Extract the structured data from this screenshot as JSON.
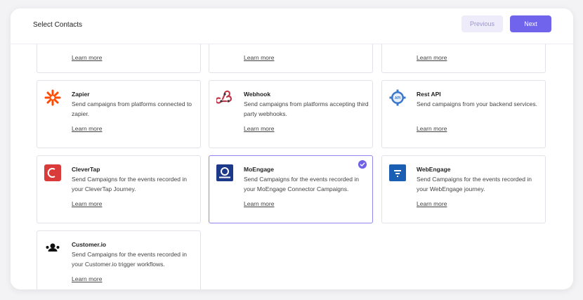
{
  "header": {
    "title": "Select Contacts",
    "previous_label": "Previous",
    "next_label": "Next"
  },
  "top_row": {
    "learn_more": "Learn more"
  },
  "cards": [
    {
      "title": "Zapier",
      "description": "Send campaigns from platforms connected to zapier.",
      "learn_more": "Learn more",
      "icon": "zapier-icon"
    },
    {
      "title": "Webhook",
      "description": "Send campaigns from platforms accepting third party webhooks.",
      "learn_more": "Learn more",
      "icon": "webhook-icon"
    },
    {
      "title": "Rest API",
      "description": "Send campaigns from your backend services.",
      "learn_more": "Learn more",
      "icon": "api-icon"
    },
    {
      "title": "CleverTap",
      "description": "Send Campaigns for the events recorded in your CleverTap Journey.",
      "learn_more": "Learn more",
      "icon": "clevertap-icon"
    },
    {
      "title": "MoEngage",
      "description": "Send Campaigns for the events recorded in your MoEngage Connector Campaigns.",
      "learn_more": "Learn more",
      "icon": "moengage-icon",
      "selected": true
    },
    {
      "title": "WebEngage",
      "description": "Send Campaigns for the events recorded in your WebEngage journey.",
      "learn_more": "Learn more",
      "icon": "webengage-icon"
    },
    {
      "title": "Customer.io",
      "description": "Send Campaigns for the events recorded in your Customer.io trigger workflows.",
      "learn_more": "Learn more",
      "icon": "customerio-icon"
    }
  ],
  "colors": {
    "accent": "#7164ec",
    "selected_border": "#8e86ee",
    "zapier": "#ff4a00",
    "clevertap": "#d93a3a",
    "moengage": "#1d3a8a",
    "webengage": "#1a5fb4"
  }
}
